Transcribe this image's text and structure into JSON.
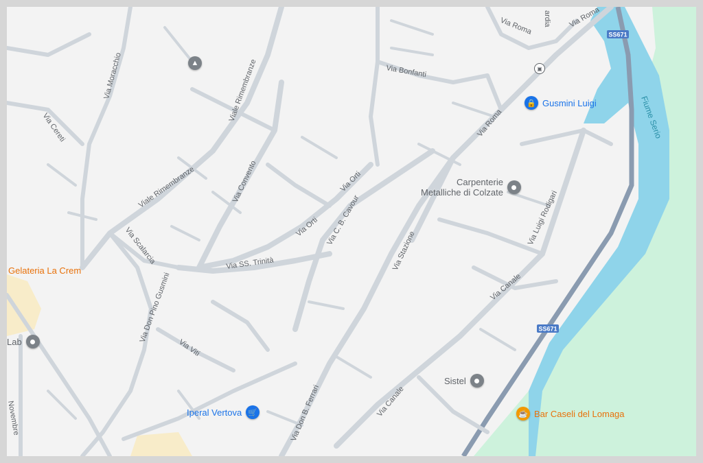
{
  "map": {
    "streets": [
      {
        "id": "via-roma-1",
        "text": "Via Roma"
      },
      {
        "id": "via-roma-2",
        "text": "Via Roma"
      },
      {
        "id": "via-roma-3",
        "text": "Via Roma"
      },
      {
        "id": "via-bonfanti",
        "text": "Via Bonfanti"
      },
      {
        "id": "via-moracchio",
        "text": "Via Moracchio"
      },
      {
        "id": "viale-rimembranze-1",
        "text": "Viale Rimembranze"
      },
      {
        "id": "viale-rimembranze-2",
        "text": "Viale Rimembranze"
      },
      {
        "id": "via-cereti",
        "text": "Via Cereti"
      },
      {
        "id": "via-convento",
        "text": "Via Convento"
      },
      {
        "id": "via-orti-1",
        "text": "Via Orti"
      },
      {
        "id": "via-orti-2",
        "text": "Via Orti"
      },
      {
        "id": "via-cb-cavour",
        "text": "Via C. B. Cavour"
      },
      {
        "id": "via-stazione",
        "text": "Via Stazione"
      },
      {
        "id": "via-luigi-rodigari",
        "text": "Via Luigi Rodigari"
      },
      {
        "id": "via-scalarcia",
        "text": "Via Scalarcia"
      },
      {
        "id": "via-ss-trinita",
        "text": "Via SS. Trinità"
      },
      {
        "id": "via-don-pino-gusmini",
        "text": "Via Don Pino Gusmini"
      },
      {
        "id": "via-viti",
        "text": "Via Viti"
      },
      {
        "id": "via-canale-1",
        "text": "Via Canale"
      },
      {
        "id": "via-canale-2",
        "text": "Via Canale"
      },
      {
        "id": "via-don-b-ferrari",
        "text": "Via Don B. Ferrari"
      },
      {
        "id": "via-novembre",
        "text": "Novembre"
      },
      {
        "id": "vardia",
        "text": "ardia"
      }
    ],
    "highway_shields": [
      "SS671",
      "SS671"
    ],
    "river_label": "Fiume Serio",
    "pois": {
      "gusmini": {
        "label": "Gusmini Luigi",
        "icon": "lock-bag-icon",
        "color": "#1a73e8"
      },
      "carpenterie": {
        "line1": "Carpenterie",
        "line2": "Metalliche di Colzate",
        "icon": "pin-icon",
        "color": "#7c8288"
      },
      "gelateria": {
        "label": "Gelateria La Crem",
        "color": "#e8710a"
      },
      "lab": {
        "label": "Lab",
        "icon": "pin-icon"
      },
      "sistel": {
        "label": "Sistel",
        "icon": "pin-icon"
      },
      "iperal": {
        "label": "Iperal Vertova",
        "icon": "cart-icon",
        "color": "#1a73e8"
      },
      "bar": {
        "label": "Bar Caseli del Lomaga",
        "icon": "cup-icon",
        "color": "#f29900"
      }
    },
    "colors": {
      "background": "#f3f3f3",
      "road": "#cfd5db",
      "highway": "#8a9bb0",
      "river": "#8fd4ea",
      "park": "#cdf2dc",
      "sand": "#f8ecc9"
    }
  }
}
